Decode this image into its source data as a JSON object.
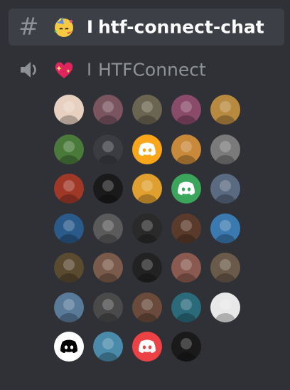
{
  "text_channel": {
    "icon": "hash-icon",
    "emoji": "partying-face",
    "separator": "I",
    "name": "htf-connect-chat"
  },
  "voice_channel": {
    "icon": "speaker-icon",
    "emoji": "sparkling-heart",
    "separator": "I",
    "name": "HTFConnect"
  },
  "members": [
    {
      "avatar": "cartoon-avatar",
      "color": "#e8d0c0"
    },
    {
      "avatar": "photo",
      "color": "#7a5560"
    },
    {
      "avatar": "photo",
      "color": "#6b6450"
    },
    {
      "avatar": "photo",
      "color": "#8a4a6a"
    },
    {
      "avatar": "photo",
      "color": "#b88a40"
    },
    {
      "avatar": "anime-avatar",
      "color": "#4a7a3a"
    },
    {
      "avatar": "photo",
      "color": "#3a3c42"
    },
    {
      "avatar": "discord-default",
      "color": "#faa61a"
    },
    {
      "avatar": "photo",
      "color": "#c88a3a"
    },
    {
      "avatar": "photo",
      "color": "#7a7a7a"
    },
    {
      "avatar": "art-avatar",
      "color": "#a03828"
    },
    {
      "avatar": "photo",
      "color": "#1a1a1a"
    },
    {
      "avatar": "photo",
      "color": "#e0a030"
    },
    {
      "avatar": "discord-default",
      "color": "#3ba55c"
    },
    {
      "avatar": "photo",
      "color": "#5a6a80"
    },
    {
      "avatar": "photo",
      "color": "#2a5a8a"
    },
    {
      "avatar": "photo",
      "color": "#5a5a5a"
    },
    {
      "avatar": "photo",
      "color": "#2a2a2a"
    },
    {
      "avatar": "photo",
      "color": "#5a3a2a"
    },
    {
      "avatar": "photo",
      "color": "#3a7ab0"
    },
    {
      "avatar": "photo",
      "color": "#5a4a30"
    },
    {
      "avatar": "photo",
      "color": "#7a5a4a"
    },
    {
      "avatar": "photo",
      "color": "#222222"
    },
    {
      "avatar": "photo",
      "color": "#8a5a50"
    },
    {
      "avatar": "photo",
      "color": "#6a5a4a"
    },
    {
      "avatar": "art-avatar",
      "color": "#5a7a9a"
    },
    {
      "avatar": "photo",
      "color": "#4a4a4a"
    },
    {
      "avatar": "photo",
      "color": "#6a4a3a"
    },
    {
      "avatar": "photo",
      "color": "#2a6a7a"
    },
    {
      "avatar": "photo",
      "color": "#e8e8e8"
    },
    {
      "avatar": "discord-default",
      "color": "#ffffff"
    },
    {
      "avatar": "photo",
      "color": "#4a8aaa"
    },
    {
      "avatar": "discord-default",
      "color": "#ed4245"
    },
    {
      "avatar": "photo",
      "color": "#1a1a1a"
    }
  ]
}
